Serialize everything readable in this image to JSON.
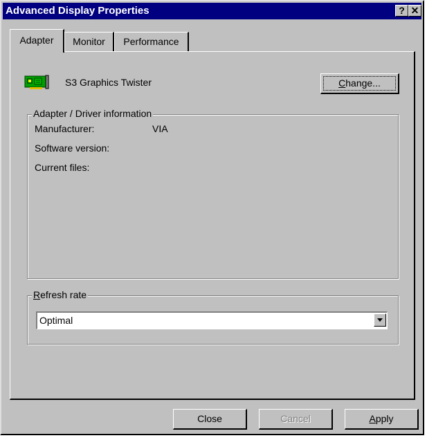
{
  "window": {
    "title": "Advanced Display Properties",
    "help_glyph": "?",
    "close_glyph": "✕"
  },
  "tabs": [
    {
      "label": "Adapter",
      "active": true
    },
    {
      "label": "Monitor",
      "active": false
    },
    {
      "label": "Performance",
      "active": false
    }
  ],
  "adapter": {
    "name": "S3 Graphics Twister",
    "icon": "display-adapter-card-icon",
    "change_button": {
      "prefix": "",
      "mnemonic": "C",
      "rest": "hange..."
    }
  },
  "driver_info": {
    "legend": "Adapter / Driver information",
    "manufacturer_label": "Manufacturer:",
    "manufacturer_value": "VIA",
    "software_version_label": "Software version:",
    "current_files_label": "Current files:"
  },
  "refresh": {
    "legend_mnemonic": "R",
    "legend_rest": "efresh rate",
    "selected": "Optimal"
  },
  "buttons": {
    "close": "Close",
    "cancel": "Cancel",
    "apply_mnemonic": "A",
    "apply_rest": "pply"
  },
  "colors": {
    "titlebar": "#000080",
    "face": "#c0c0c0",
    "adapter_icon_green": "#00a000"
  }
}
